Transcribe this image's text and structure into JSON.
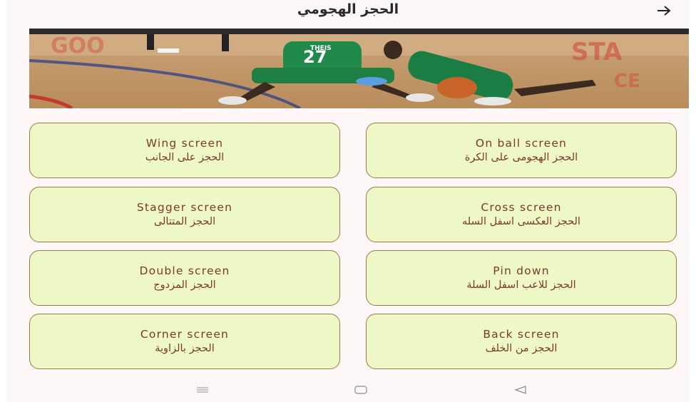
{
  "appbar": {
    "title": "الحجز الهجومي",
    "back_icon": "arrow-forward-icon"
  },
  "banner": {
    "jersey_name": "THEIS",
    "jersey_number": "27"
  },
  "cards": [
    {
      "name": "wing-screen",
      "en": "Wing screen",
      "ar": "الحجز على الجانب"
    },
    {
      "name": "on-ball-screen",
      "en": "On ball screen",
      "ar": "الحجز الهجومى على الكرة"
    },
    {
      "name": "stagger-screen",
      "en": "Stagger screen",
      "ar": "الحجز المتتالى"
    },
    {
      "name": "cross-screen",
      "en": "Cross screen",
      "ar": "الحجز العكسى اسفل السله"
    },
    {
      "name": "double-screen",
      "en": "Double screen",
      "ar": "الحجز المزدوج"
    },
    {
      "name": "pin-down",
      "en": "Pin down",
      "ar": "الحجز للاعب اسفل السلة"
    },
    {
      "name": "corner-screen",
      "en": "Corner screen",
      "ar": "الحجز بالزاوية"
    },
    {
      "name": "back-screen",
      "en": "Back screen",
      "ar": "الحجز من الخلف"
    }
  ],
  "navbar": {
    "items": [
      "menu-icon",
      "home-icon",
      "back-triangle-icon"
    ]
  },
  "colors": {
    "card_bg": "#eef7c6",
    "card_border": "#9a7a44",
    "card_text": "#7a3a2a",
    "screen_bg": "#fdf8f7"
  }
}
